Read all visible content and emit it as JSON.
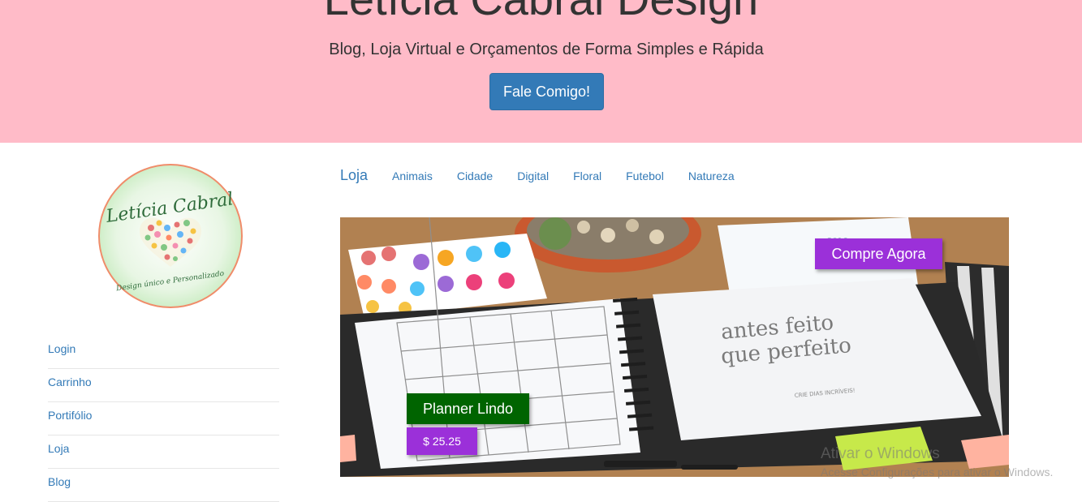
{
  "hero": {
    "title": "Letícia Cabral Design",
    "subtitle": "Blog, Loja Virtual e Orçamentos de Forma Simples e Rápida",
    "button_label": "Fale Comigo!"
  },
  "logo": {
    "script_text": "Letícia Cabral",
    "tagline": "Design único e Personalizado"
  },
  "sidebar": {
    "items": [
      {
        "label": "Login"
      },
      {
        "label": "Carrinho"
      },
      {
        "label": "Portifólio"
      },
      {
        "label": "Loja"
      },
      {
        "label": "Blog"
      }
    ]
  },
  "categories": {
    "title": "Loja",
    "items": [
      "Animais",
      "Cidade",
      "Digital",
      "Floral",
      "Futebol",
      "Natureza"
    ]
  },
  "banner": {
    "buy_label": "Compre Agora",
    "product_name": "Planner Lindo",
    "price": "$ 25.25",
    "planner_text_line1": "antes feito",
    "planner_text_line2": "que perfeito",
    "planner_small_text": "CRIE DIAS INCRÍVEIS!",
    "calendar_year": "2016"
  },
  "watermark": {
    "title": "Ativar o Windows",
    "subtitle": "Acesse Configurações para ativar o Windows."
  },
  "colors": {
    "hero_bg": "#ffbbc8",
    "primary": "#337ab7",
    "purple": "#9b30d9",
    "green": "#006400"
  }
}
